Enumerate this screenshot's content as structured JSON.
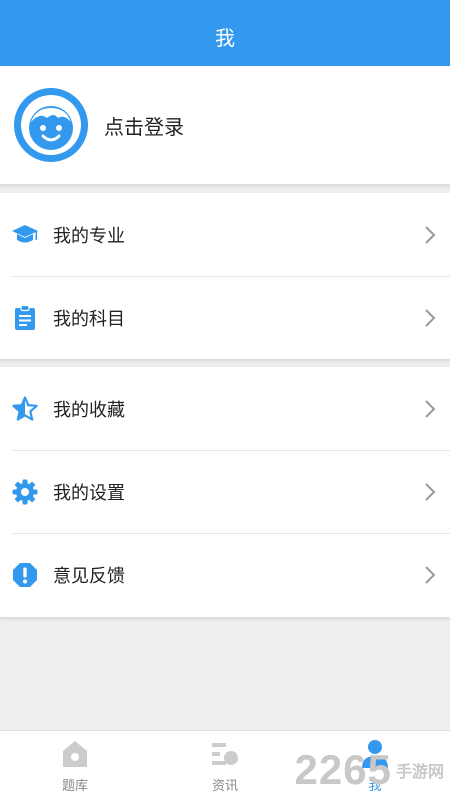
{
  "header": {
    "title": "我"
  },
  "profile": {
    "login_text": "点击登录"
  },
  "menu_group_1": [
    {
      "label": "我的专业",
      "icon": "graduation-cap-icon"
    },
    {
      "label": "我的科目",
      "icon": "clipboard-icon"
    }
  ],
  "menu_group_2": [
    {
      "label": "我的收藏",
      "icon": "star-icon"
    },
    {
      "label": "我的设置",
      "icon": "gear-icon"
    },
    {
      "label": "意见反馈",
      "icon": "exclamation-octagon-icon"
    }
  ],
  "tabs": [
    {
      "label": "题库",
      "icon": "home-icon"
    },
    {
      "label": "资讯",
      "icon": "news-icon"
    },
    {
      "label": "我",
      "icon": "person-icon",
      "active": true
    }
  ],
  "watermark": {
    "number": "2265",
    "text": "手游网"
  },
  "colors": {
    "accent": "#3399ee",
    "background": "#eeeeee",
    "inactive_icon": "#cccccc"
  }
}
